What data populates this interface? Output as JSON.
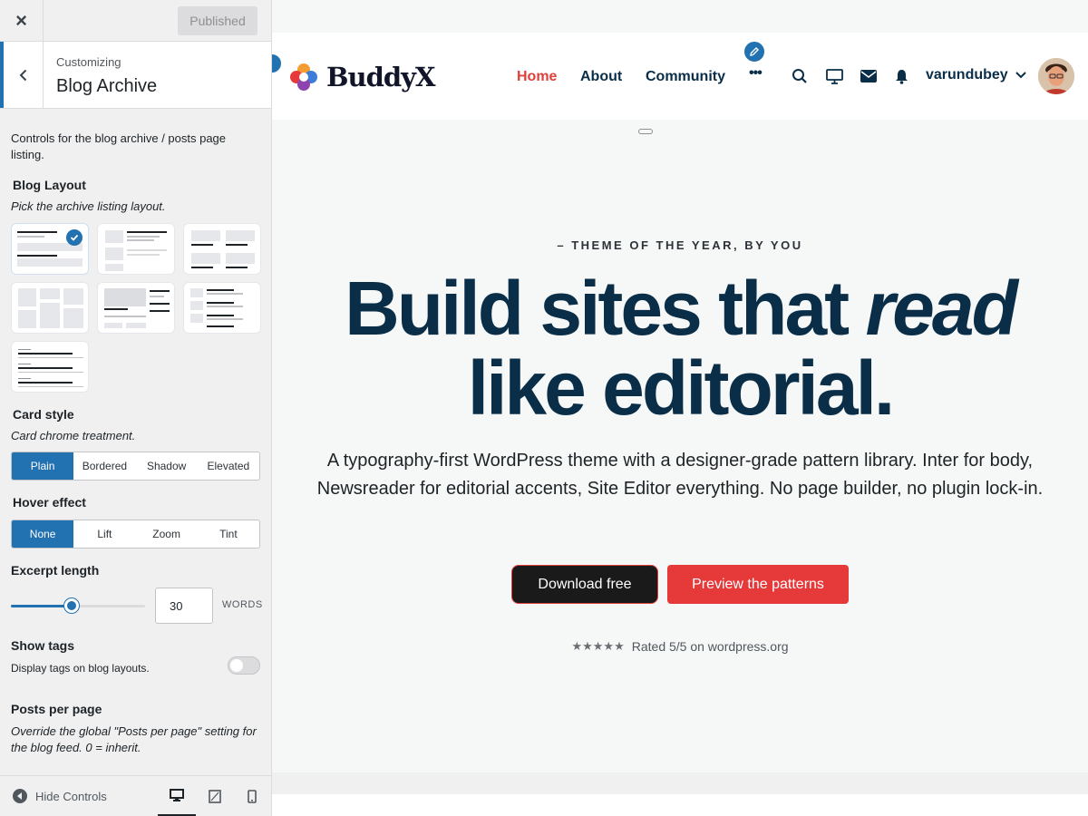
{
  "customizer": {
    "close_label": "×",
    "published_label": "Published",
    "customizing_label": "Customizing",
    "section_title": "Blog Archive",
    "description": "Controls for the blog archive / posts page listing.",
    "blog_layout": {
      "title": "Blog Layout",
      "help": "Pick the archive listing layout.",
      "tiles": 7,
      "selected_index": 0
    },
    "card_style": {
      "title": "Card style",
      "help": "Card chrome treatment.",
      "options": [
        "Plain",
        "Bordered",
        "Shadow",
        "Elevated"
      ],
      "selected": "Plain"
    },
    "hover_effect": {
      "title": "Hover effect",
      "options": [
        "None",
        "Lift",
        "Zoom",
        "Tint"
      ],
      "selected": "None"
    },
    "excerpt_length": {
      "title": "Excerpt length",
      "value": "30",
      "unit": "WORDS",
      "slider_fraction": 0.45
    },
    "show_tags": {
      "title": "Show tags",
      "description": "Display tags on blog layouts.",
      "enabled": false
    },
    "posts_per_page": {
      "title": "Posts per page",
      "help": "Override the global \"Posts per page\" setting for the blog feed. 0 = inherit."
    },
    "footer": {
      "hide_controls_label": "Hide Controls",
      "devices": [
        "desktop-icon",
        "tablet-icon",
        "mobile-icon"
      ],
      "active_device": "desktop-icon"
    }
  },
  "site": {
    "logo_text": "BuddyX",
    "nav": [
      "Home",
      "About",
      "Community",
      "•••"
    ],
    "active_nav": "Home",
    "username": "varundubey",
    "header_icons": [
      "search-icon",
      "monitor-icon",
      "mail-icon",
      "bell-icon"
    ]
  },
  "hero": {
    "kicker": "– THEME OF THE YEAR, BY YOU",
    "title_line1_prefix": "Build sites that ",
    "title_line1_em": "read",
    "title_line2": "like editorial.",
    "subtitle": "A typography-first WordPress theme with a designer-grade pattern library. Inter for body, Newsreader for editorial accents, Site Editor everything. No page builder, no plugin lock-in.",
    "primary_button": "Download free",
    "secondary_button": "Preview the patterns",
    "stars": "★★★★★",
    "rating_text": "Rated 5/5 on wordpress.org"
  },
  "colors": {
    "accent": "#2271b1",
    "brand_red": "#e5393a",
    "heading_navy": "#0a2e48"
  }
}
